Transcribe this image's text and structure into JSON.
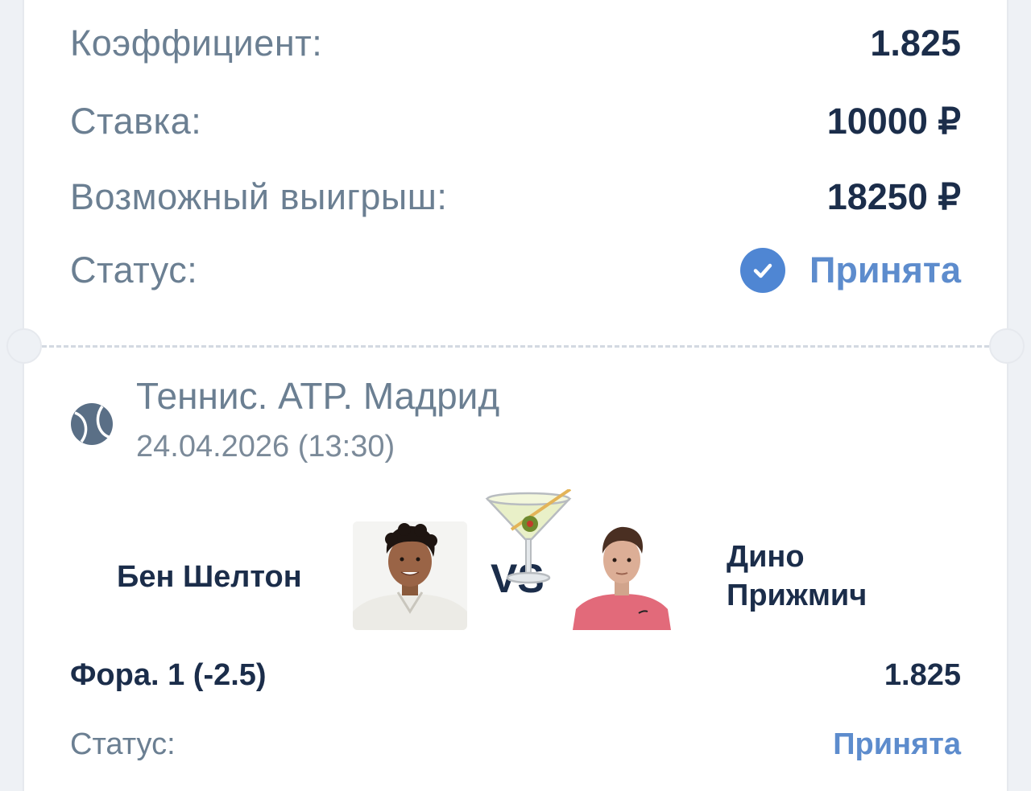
{
  "summary": {
    "odds_label": "Коэффициент:",
    "odds_value": "1.825",
    "stake_label": "Ставка:",
    "stake_value": "10000 ₽",
    "win_label": "Возможный выигрыш:",
    "win_value": "18250 ₽",
    "status_label": "Статус:",
    "status_value": "Принята"
  },
  "event": {
    "title": "Теннис. ATP. Мадрид",
    "datetime": "24.04.2026 (13:30)",
    "icon": "tennis-ball-icon"
  },
  "match": {
    "player1": "Бен Шелтон",
    "player2_line1": "Дино",
    "player2_line2": "Прижмич",
    "vs": "VS",
    "overlay_icon": "cocktail-glass-icon"
  },
  "bet": {
    "market": "Фора. 1 (-2.5)",
    "odds": "1.825",
    "status_label": "Статус:",
    "status_value": "Принята"
  },
  "colors": {
    "dark_text": "#1b2d4a",
    "muted_text": "#6b7f92",
    "accent_blue": "#4f86d3",
    "accepted_text": "#5d8ccd"
  }
}
